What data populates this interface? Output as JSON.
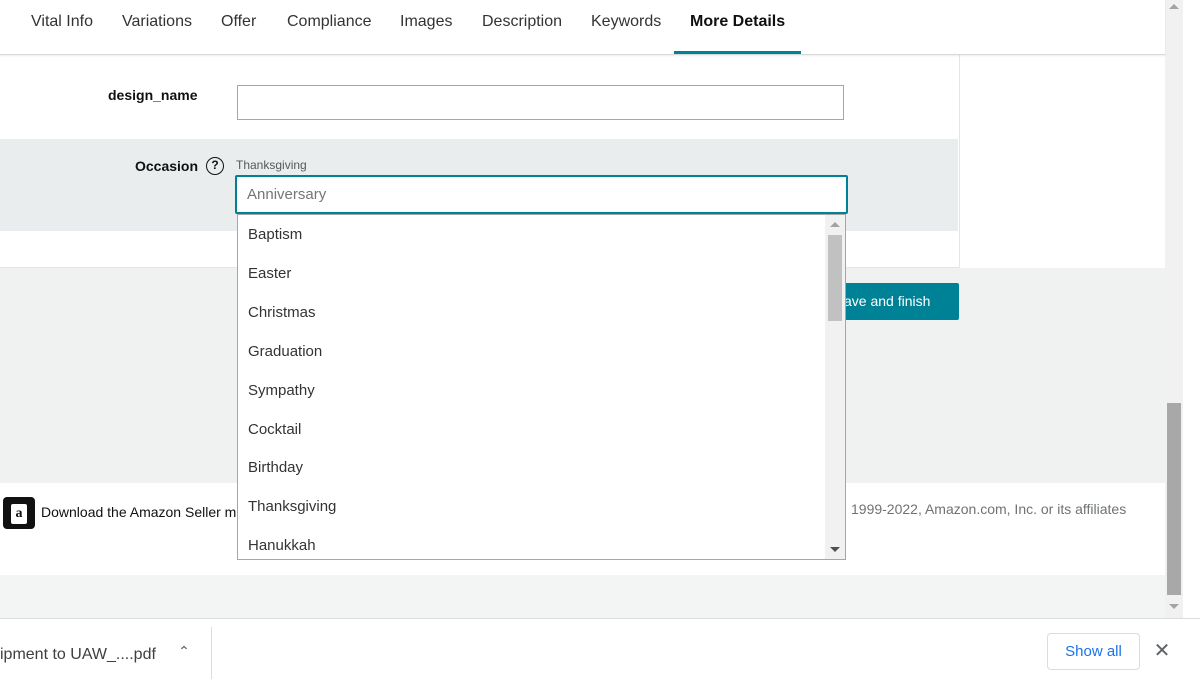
{
  "tabs": [
    {
      "label": "Vital Info"
    },
    {
      "label": "Variations"
    },
    {
      "label": "Offer"
    },
    {
      "label": "Compliance"
    },
    {
      "label": "Images"
    },
    {
      "label": "Description"
    },
    {
      "label": "Keywords"
    },
    {
      "label": "More Details",
      "active": true
    }
  ],
  "form": {
    "design_name": {
      "label": "design_name",
      "value": ""
    },
    "occasion": {
      "label": "Occasion",
      "help_icon": "question-circle-icon",
      "selected_value": "Thanksgiving",
      "input_placeholder": "Anniversary"
    }
  },
  "dropdown": {
    "options": [
      "Baptism",
      "Easter",
      "Christmas",
      "Graduation",
      "Sympathy",
      "Cocktail",
      "Birthday",
      "Thanksgiving",
      "Hanukkah"
    ]
  },
  "actions": {
    "save_label": "ave and finish"
  },
  "footer": {
    "app_promo": "Download the Amazon Seller m",
    "copyright": "1999-2022, Amazon.com, Inc. or its affiliates",
    "app_icon": "amazon-seller-app-icon"
  },
  "download_bar": {
    "file_name": "ipment to UAW_....pdf",
    "show_all_label": "Show all",
    "chevron_icon": "chevron-up-icon",
    "close_icon": "close-icon"
  },
  "colors": {
    "accent": "#008296",
    "link": "#1a73e8"
  }
}
